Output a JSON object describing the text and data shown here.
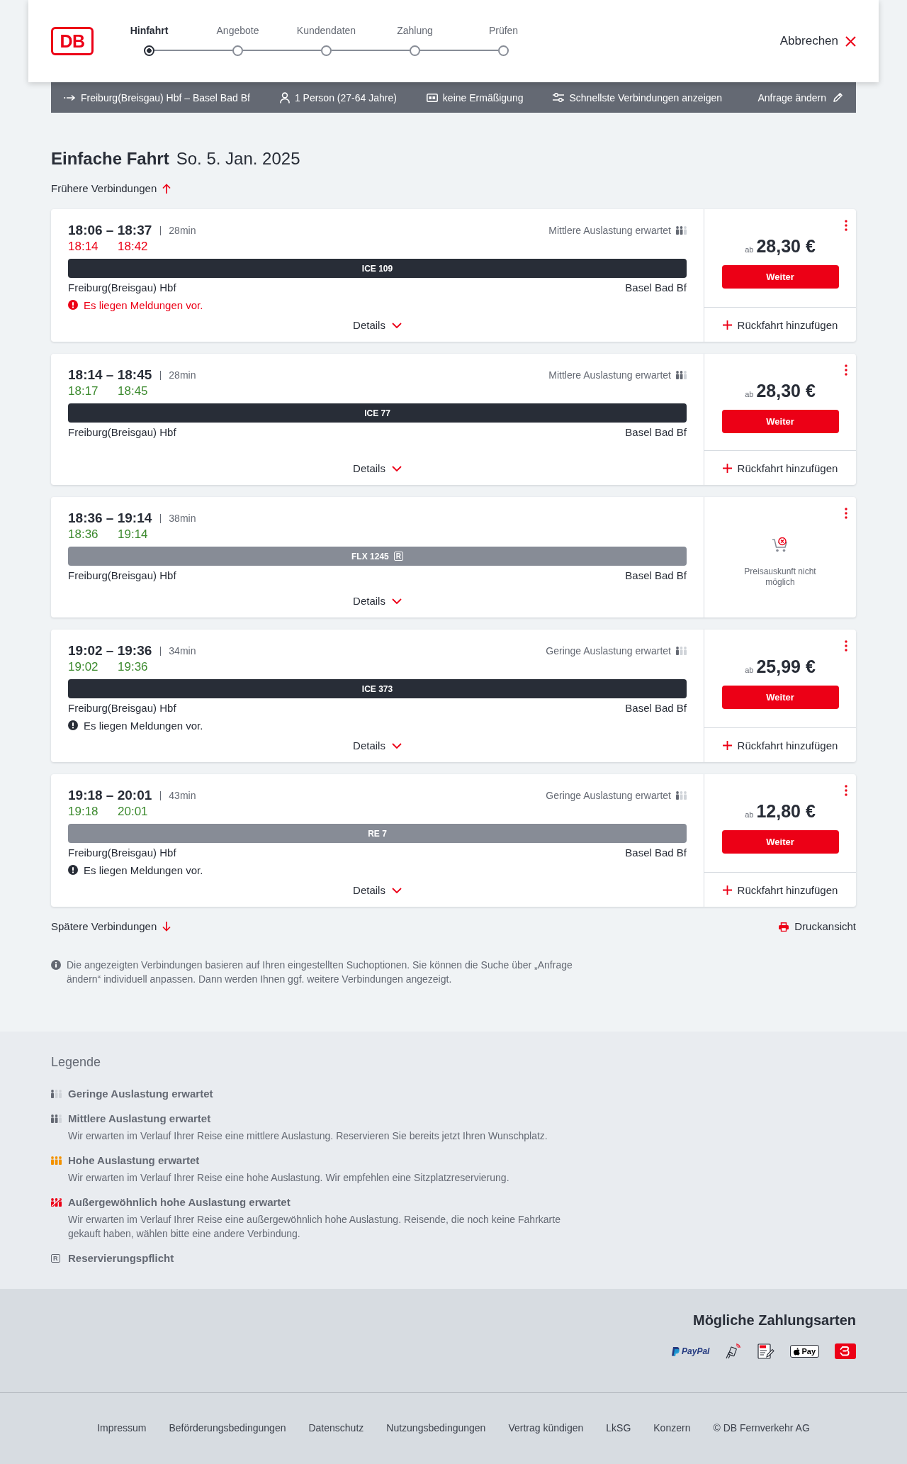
{
  "header": {
    "logo": "DB",
    "steps": [
      {
        "label": "Hinfahrt",
        "selected": true
      },
      {
        "label": "Angebote",
        "selected": false
      },
      {
        "label": "Kundendaten",
        "selected": false
      },
      {
        "label": "Zahlung",
        "selected": false
      },
      {
        "label": "Prüfen",
        "selected": false
      }
    ],
    "cancel": "Abbrechen"
  },
  "search_summary": {
    "route": "Freiburg(Breisgau) Hbf – Basel Bad Bf",
    "travellers": "1 Person (27-64 Jahre)",
    "discount": "keine Ermäßigung",
    "option": "Schnellste Verbindungen anzeigen",
    "edit": "Anfrage ändern"
  },
  "heading": {
    "trip_type": "Einfache Fahrt",
    "date": "So. 5. Jan. 2025"
  },
  "earlier_link": "Frühere Verbindungen",
  "connections": [
    {
      "times": "18:06 – 18:37",
      "duration": "28min",
      "realtime": {
        "departure": {
          "time": "18:14",
          "delayed": true
        },
        "arrival": {
          "time": "18:42",
          "delayed": true
        }
      },
      "occupancy": {
        "kind": "medium",
        "label": "Mittlere Auslastung erwartet"
      },
      "train": {
        "label": "ICE 109",
        "color": "#282d37"
      },
      "from": "Freiburg(Breisgau) Hbf",
      "to": "Basel Bad Bf",
      "message": {
        "kind": "alert",
        "text": "Es liegen Meldungen vor."
      },
      "details": "Details",
      "offer": {
        "kind": "price",
        "prefix": "ab",
        "price": "28,30 €",
        "button": "Weiter",
        "return_trip": "Rückfahrt hinzufügen"
      }
    },
    {
      "times": "18:14 – 18:45",
      "duration": "28min",
      "realtime": {
        "departure": {
          "time": "18:17",
          "delayed": false
        },
        "arrival": {
          "time": "18:45",
          "delayed": false
        }
      },
      "occupancy": {
        "kind": "medium",
        "label": "Mittlere Auslastung erwartet"
      },
      "train": {
        "label": "ICE 77",
        "color": "#282d37"
      },
      "from": "Freiburg(Breisgau) Hbf",
      "to": "Basel Bad Bf",
      "details": "Details",
      "offer": {
        "kind": "price",
        "prefix": "ab",
        "price": "28,30 €",
        "button": "Weiter",
        "return_trip": "Rückfahrt hinzufügen"
      }
    },
    {
      "times": "18:36 – 19:14",
      "duration": "38min",
      "realtime": {
        "departure": {
          "time": "18:36",
          "delayed": false
        },
        "arrival": {
          "time": "19:14",
          "delayed": false
        }
      },
      "train": {
        "label": "FLX 1245",
        "color": "#878c96",
        "badge": "R"
      },
      "from": "Freiburg(Breisgau) Hbf",
      "to": "Basel Bad Bf",
      "details": "Details",
      "offer": {
        "kind": "unavailable",
        "text": "Preisauskunft nicht möglich"
      }
    },
    {
      "times": "19:02 – 19:36",
      "duration": "34min",
      "realtime": {
        "departure": {
          "time": "19:02",
          "delayed": false
        },
        "arrival": {
          "time": "19:36",
          "delayed": false
        }
      },
      "occupancy": {
        "kind": "low",
        "label": "Geringe Auslastung erwartet"
      },
      "train": {
        "label": "ICE 373",
        "color": "#282d37"
      },
      "from": "Freiburg(Breisgau) Hbf",
      "to": "Basel Bad Bf",
      "message": {
        "kind": "notice",
        "text": "Es liegen Meldungen vor."
      },
      "details": "Details",
      "offer": {
        "kind": "price",
        "prefix": "ab",
        "price": "25,99 €",
        "button": "Weiter",
        "return_trip": "Rückfahrt hinzufügen"
      }
    },
    {
      "times": "19:18 – 20:01",
      "duration": "43min",
      "realtime": {
        "departure": {
          "time": "19:18",
          "delayed": false
        },
        "arrival": {
          "time": "20:01",
          "delayed": false
        }
      },
      "occupancy": {
        "kind": "low",
        "label": "Geringe Auslastung erwartet"
      },
      "train": {
        "label": "RE 7",
        "color": "#878c96"
      },
      "from": "Freiburg(Breisgau) Hbf",
      "to": "Basel Bad Bf",
      "message": {
        "kind": "notice",
        "text": "Es liegen Meldungen vor."
      },
      "details": "Details",
      "offer": {
        "kind": "price",
        "prefix": "ab",
        "price": "12,80 €",
        "button": "Weiter",
        "return_trip": "Rückfahrt hinzufügen"
      }
    }
  ],
  "later_link": "Spätere Verbindungen",
  "print_link": "Druckansicht",
  "info_note": "Die angezeigten Verbindungen basieren auf Ihren eingestellten Suchoptionen. Sie können die Suche über „Anfrage ändern“ individuell anpassen. Dann werden Ihnen ggf. weitere Verbindungen angezeigt.",
  "legend": {
    "title": "Legende",
    "items": [
      {
        "kind": "low",
        "title": "Geringe Auslastung erwartet"
      },
      {
        "kind": "medium",
        "title": "Mittlere Auslastung erwartet",
        "description": "Wir erwarten im Verlauf Ihrer Reise eine mittlere Auslastung. Reservieren Sie bereits jetzt Ihren Wunschplatz."
      },
      {
        "kind": "high",
        "title": "Hohe Auslastung erwartet",
        "description": "Wir erwarten im Verlauf Ihrer Reise eine hohe Auslastung. Wir empfehlen eine Sitzplatzreservierung."
      },
      {
        "kind": "very_high",
        "title": "Außergewöhnlich hohe Auslastung erwartet",
        "description": "Wir erwarten im Verlauf Ihrer Reise eine außergewöhnlich hohe Auslastung. Reisende, die noch keine Fahrkarte gekauft haben, wählen bitte eine andere Verbindung."
      },
      {
        "kind": "reservation",
        "badge": "R",
        "title": "Reservierungspflicht"
      }
    ]
  },
  "payments": {
    "title": "Mögliche Zahlungsarten",
    "methods": [
      {
        "kind": "paypal",
        "label": "PayPal"
      },
      {
        "kind": "contactless"
      },
      {
        "kind": "sepa"
      },
      {
        "kind": "apple_pay",
        "label": "Pay"
      },
      {
        "kind": "bahnbonus"
      }
    ]
  },
  "footer": {
    "links": [
      "Impressum",
      "Beförderungsbedingungen",
      "Datenschutz",
      "Nutzungsbedingungen",
      "Vertrag kündigen",
      "LkSG",
      "Konzern"
    ],
    "copyright": "© DB Fernverkehr AG"
  }
}
